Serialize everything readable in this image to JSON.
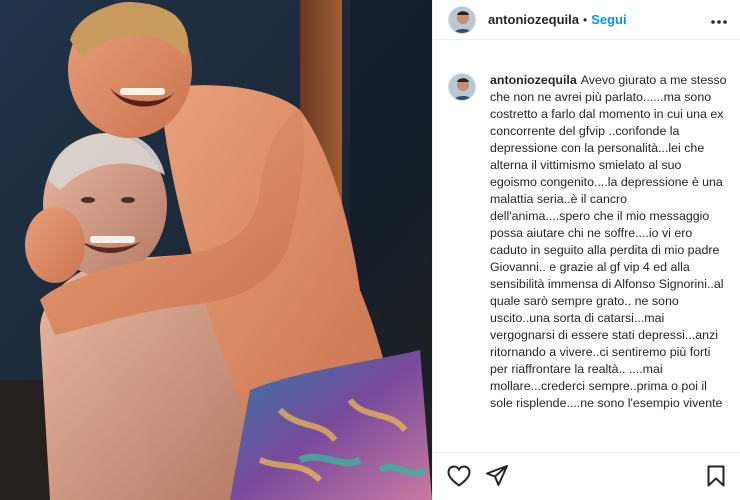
{
  "post": {
    "username": "antoniozequila",
    "separator": "•",
    "follow_label": "Segui",
    "more_icon": "more-icon",
    "caption": "Avevo giurato a me stesso che non ne avrei più parlato......ma sono costretto a farlo dal momento in cui una ex concorrente del gfvip ..confonde la depressione con la personalità...lei che alterna il vittimismo smielato al suo egoismo congenito....la depressione è una malattia seria..è il cancro dell'anima....spero che il mio messaggio possa aiutare chi ne soffre....io vi ero caduto in seguito alla perdita di mio padre Giovanni.. e grazie al gf vip 4 ed alla sensibilità immensa di Alfonso Signorini..al quale sarò sempre grato.. ne sono uscito..una sorta di catarsi...mai vergognarsi di essere stati depressi...anzi ritornando a vivere..ci sentiremo più forti per riaffrontare la realtà.. ....mai mollare...crederci sempre..prima o poi il sole risplende....ne sono l'esempio vivente"
  },
  "actions": {
    "like_icon": "heart-icon",
    "share_icon": "share-icon",
    "save_icon": "bookmark-icon"
  },
  "colors": {
    "follow": "#0095f6",
    "text": "#262626",
    "border": "#efefef"
  }
}
